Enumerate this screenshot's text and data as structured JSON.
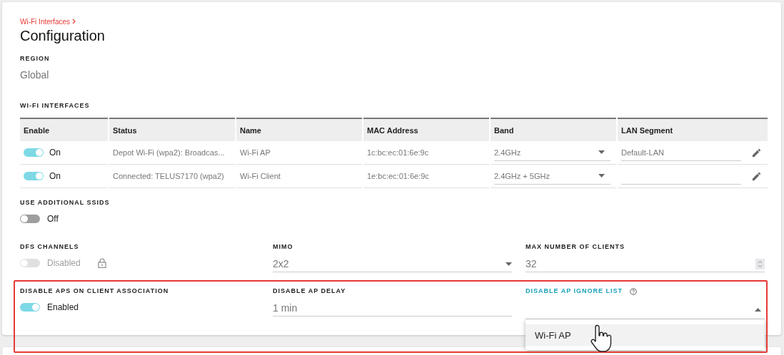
{
  "breadcrumb": {
    "label": "Wi-Fi Interfaces"
  },
  "title": "Configuration",
  "region": {
    "label": "REGION",
    "value": "Global"
  },
  "interfaces": {
    "label": "WI-FI INTERFACES",
    "columns": [
      "Enable",
      "Status",
      "Name",
      "MAC Address",
      "Band",
      "LAN Segment"
    ],
    "rows": [
      {
        "enabled": true,
        "toggle_label": "On",
        "status": "Depot Wi-Fi (wpa2): Broadcas...",
        "name": "Wi-Fi AP",
        "mac": "1c:bc:ec:01:6e:9c",
        "band": "2.4GHz",
        "lan_segment": "Default-LAN"
      },
      {
        "enabled": true,
        "toggle_label": "On",
        "status": "Connected: TELUS7170 (wpa2)",
        "name": "Wi-Fi Client",
        "mac": "1e:bc:ec:01:6e:9c",
        "band": "2.4GHz + 5GHz"
      }
    ]
  },
  "additional_ssids": {
    "label": "USE ADDITIONAL SSIDS",
    "on": false,
    "disabled": false,
    "state_label": "Off"
  },
  "dfs_channels": {
    "label": "DFS CHANNELS",
    "on": false,
    "disabled": true,
    "locked": true,
    "state_label": "Disabled"
  },
  "mimo": {
    "label": "MIMO",
    "value": "2x2"
  },
  "max_clients": {
    "label": "MAX NUMBER OF CLIENTS",
    "value": "32"
  },
  "disable_aps": {
    "label": "DISABLE APS ON CLIENT ASSOCIATION",
    "on": true,
    "disabled": false,
    "state_label": "Enabled"
  },
  "disable_ap_delay": {
    "label": "DISABLE AP DELAY",
    "value": "1 min"
  },
  "ignore_list": {
    "label": "DISABLE AP IGNORE LIST",
    "focused": true,
    "expanded": true,
    "options": [
      {
        "label": "Wi-Fi AP",
        "hovered": true
      }
    ]
  }
}
